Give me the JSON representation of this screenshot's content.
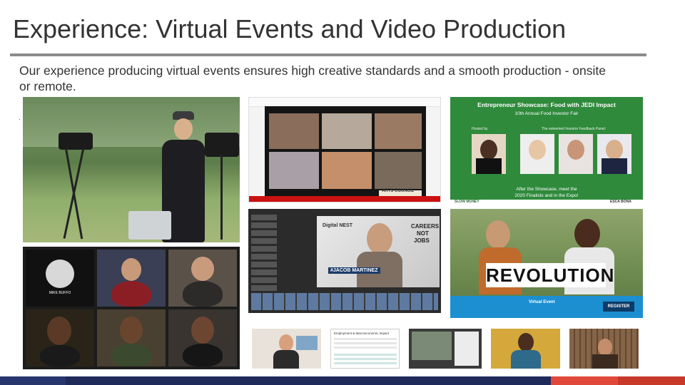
{
  "slide": {
    "title": "Experience: Virtual Events and Video Production",
    "subtitle": "Our experience producing virtual events ensures high creative standards and a smooth production - onsite or remote.",
    "bullet": "."
  },
  "photos": {
    "showcase": {
      "heading": "Entrepreneur Showcase: Food with JEDI Impact",
      "subheading": "10th Annual Food Investor Fair",
      "hosted_by": "Hosted by",
      "panel_label": "The esteemed Investor Feedback Panel:",
      "footer_line1": "After the Showcase, meet the",
      "footer_line2": "2020 Finalists and in the Expo!",
      "brand_left": "SLOW MONEY",
      "brand_right": "ESCA BONA"
    },
    "editor": {
      "brand": "Digital NEST",
      "slogan_1": "CAREERS",
      "slogan_2": "NOT",
      "slogan_3": "JOBS",
      "lower_third": "#JACOB MARTINEZ"
    },
    "revolution": {
      "word": "REVOLUTION",
      "event_label": "Virtual Event",
      "button": "REGISTER"
    },
    "zoom": {
      "name_badge": "MIKE BUFFO"
    },
    "doc": {
      "heading": "Employment & Macroeconomic Impact"
    },
    "arts": {
      "logo": "ARTS COUNCIL"
    }
  },
  "colors": {
    "title": "#333333",
    "rule": "#8c8c8c",
    "navy": "#1f2a5a",
    "red": "#e0493a",
    "green": "#2f8a3c",
    "blue_band": "#1c8fd1"
  }
}
